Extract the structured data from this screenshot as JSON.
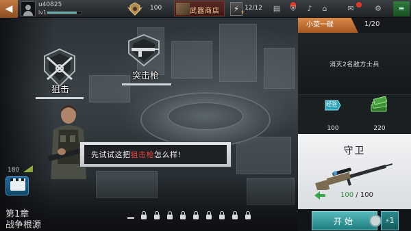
{
  "topbar": {
    "back_icon": "back-arrow-icon",
    "username": "u40825",
    "level": "lv1",
    "xp_progress": 0.85,
    "rank_value": "100",
    "shop_label": "武器商店",
    "energy_value": "12/12"
  },
  "missions": [
    {
      "label": "狙击",
      "icon": "sniper-emblem-icon"
    },
    {
      "label": "突击枪",
      "icon": "assault-rifle-emblem-icon"
    }
  ],
  "dialog": {
    "text_before": "先试试这把",
    "highlight": "狙击枪",
    "text_after": "怎么样!"
  },
  "left_bottom": {
    "count": "180",
    "chapter_number": "第1章",
    "chapter_name": "战争根源"
  },
  "pagination": {
    "total": 10,
    "current": 0
  },
  "panel": {
    "title": "小菜一碟",
    "counter": "1/20",
    "objective": "消灭2名敌方士兵",
    "rewards": [
      {
        "icon": "experience-icon",
        "label": "经验",
        "value": "100"
      },
      {
        "icon": "cash-icon",
        "value": "220"
      }
    ],
    "mode_title": "守卫",
    "ammo_current": "100",
    "ammo_sep": " / ",
    "ammo_max": "100",
    "start_label": "开始",
    "start_cost": "1"
  },
  "colors": {
    "accent_orange": "#c8743a",
    "start_teal": "#2e9a9c",
    "highlight_red": "#f04040"
  }
}
